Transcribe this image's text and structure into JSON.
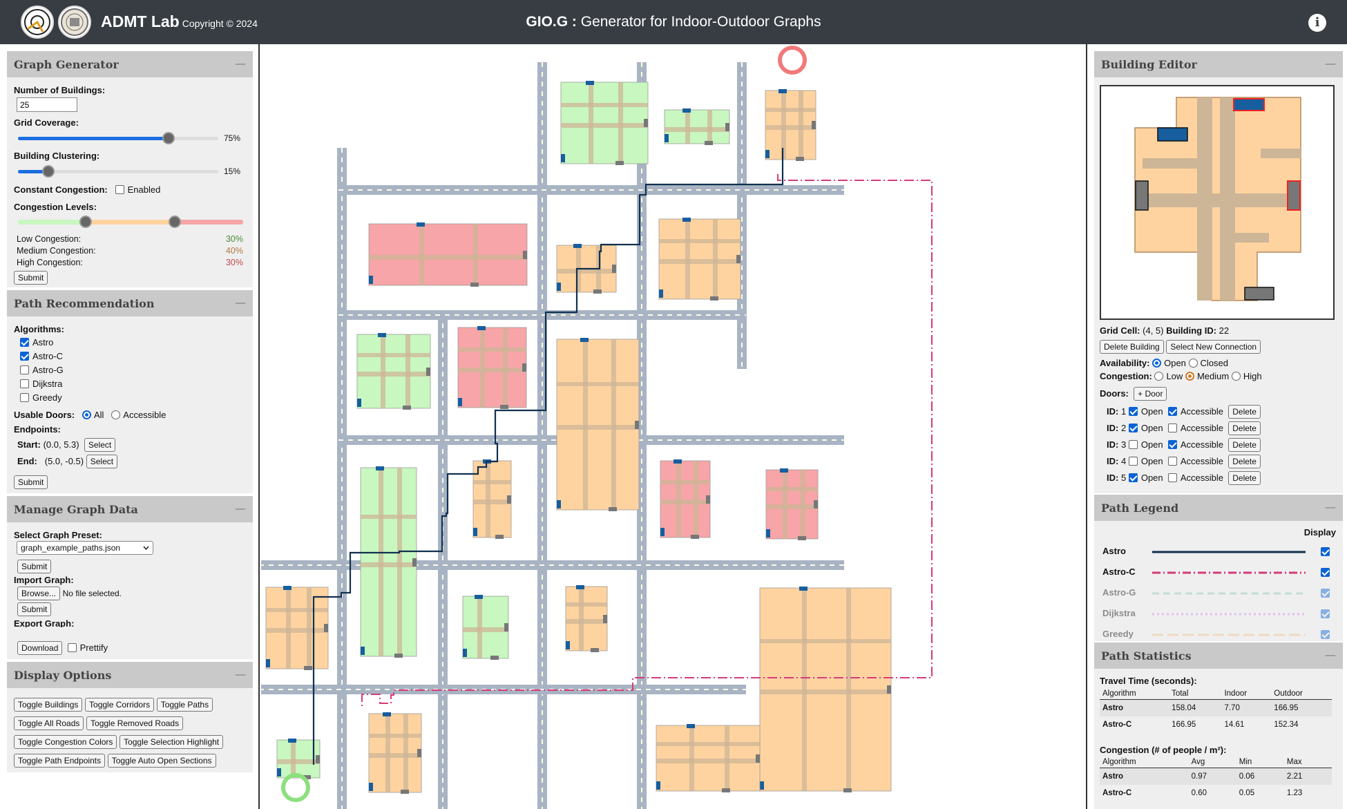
{
  "header": {
    "brand": "ADMT Lab",
    "copyright": "Copyright © 2024",
    "title_bold": "GIO.G :",
    "title_rest": " Generator for Indoor-Outdoor Graphs",
    "info_glyph": "i"
  },
  "generator": {
    "title": "Graph Generator",
    "minimize": "—",
    "num_buildings_label": "Number of Buildings:",
    "num_buildings_value": "25",
    "grid_coverage_label": "Grid Coverage:",
    "grid_coverage_value": "75%",
    "grid_coverage_fraction": 0.75,
    "clustering_label": "Building Clustering:",
    "clustering_value": "15%",
    "clustering_fraction": 0.15,
    "constant_congestion_label": "Constant Congestion:",
    "enabled_label": "Enabled",
    "congestion_levels_label": "Congestion Levels:",
    "low_label": "Low Congestion:",
    "low_value": "30%",
    "medium_label": "Medium Congestion:",
    "medium_value": "40%",
    "high_label": "High Congestion:",
    "high_value": "30%",
    "submit": "Submit"
  },
  "path_rec": {
    "title": "Path Recommendation",
    "minimize": "—",
    "algorithms_label": "Algorithms:",
    "algorithms": [
      {
        "name": "Astro",
        "checked": true
      },
      {
        "name": "Astro-C",
        "checked": true
      },
      {
        "name": "Astro-G",
        "checked": false
      },
      {
        "name": "Dijkstra",
        "checked": false
      },
      {
        "name": "Greedy",
        "checked": false
      }
    ],
    "usable_doors_label": "Usable Doors:",
    "doors_all": "All",
    "doors_accessible": "Accessible",
    "endpoints_label": "Endpoints:",
    "start_label": "Start:",
    "start_value": "(0.0, 5.3)",
    "end_label": "End:",
    "end_value": "(5.0, -0.5)",
    "select": "Select",
    "submit": "Submit"
  },
  "manage": {
    "title": "Manage Graph Data",
    "minimize": "—",
    "preset_label": "Select Graph Preset:",
    "preset_value": "graph_example_paths.json",
    "submit": "Submit",
    "import_label": "Import Graph:",
    "browse": "Browse...",
    "no_file": "No file selected.",
    "export_label": "Export Graph:",
    "download": "Download",
    "prettify": "Prettify"
  },
  "display": {
    "title": "Display Options",
    "minimize": "—",
    "buttons": [
      "Toggle Buildings",
      "Toggle Corridors",
      "Toggle Paths",
      "Toggle All Roads",
      "Toggle Removed Roads",
      "Toggle Congestion Colors",
      "Toggle Selection Highlight",
      "Toggle Path Endpoints",
      "Toggle Auto Open Sections"
    ]
  },
  "editor": {
    "title": "Building Editor",
    "minimize": "—",
    "grid_cell_label": "Grid Cell:",
    "grid_cell_value": "(4, 5)",
    "building_id_label": "Building ID:",
    "building_id_value": "22",
    "delete_building": "Delete Building",
    "select_connection": "Select New Connection",
    "availability_label": "Availability:",
    "open": "Open",
    "closed": "Closed",
    "congestion_label": "Congestion:",
    "low": "Low",
    "medium": "Medium",
    "high": "High",
    "doors_label": "Doors:",
    "add_door": "+ Door",
    "id_label": "ID:",
    "accessible": "Accessible",
    "delete": "Delete",
    "doors": [
      {
        "id": "1",
        "open": true,
        "accessible": true
      },
      {
        "id": "2",
        "open": true,
        "accessible": false
      },
      {
        "id": "3",
        "open": false,
        "accessible": true
      },
      {
        "id": "4",
        "open": false,
        "accessible": false
      },
      {
        "id": "5",
        "open": true,
        "accessible": false
      }
    ]
  },
  "legend": {
    "title": "Path Legend",
    "minimize": "—",
    "display_label": "Display",
    "items": [
      {
        "name": "Astro",
        "color": "#10304f",
        "dash": "solid",
        "active": true
      },
      {
        "name": "Astro-C",
        "color": "#d63a7a",
        "dash": "dashdot",
        "active": true
      },
      {
        "name": "Astro-G",
        "color": "#8dc7b4",
        "dash": "dash",
        "active": false
      },
      {
        "name": "Dijkstra",
        "color": "#d486e8",
        "dash": "dot",
        "active": false
      },
      {
        "name": "Greedy",
        "color": "#efc08c",
        "dash": "longdash",
        "active": false
      }
    ]
  },
  "stats": {
    "title": "Path Statistics",
    "minimize": "—",
    "travel_title": "Travel Time (seconds):",
    "travel_headers": [
      "Algorithm",
      "Total",
      "Indoor",
      "Outdoor"
    ],
    "travel_rows": [
      [
        "Astro",
        "158.04",
        "7.70",
        "166.95"
      ],
      [
        "Astro-C",
        "166.95",
        "14.61",
        "152.34"
      ]
    ],
    "congestion_title": "Congestion (# of people / m²):",
    "congestion_headers": [
      "Algorithm",
      "Avg",
      "Min",
      "Max"
    ],
    "congestion_rows": [
      [
        "Astro",
        "0.97",
        "0.06",
        "2.21"
      ],
      [
        "Astro-C",
        "0.60",
        "0.05",
        "1.23"
      ]
    ]
  },
  "colors": {
    "low": "#c8f7c0",
    "medium": "#ffd3a0",
    "high": "#f7a5a8",
    "road": "#a8b4c4",
    "corridor": "#cdb597",
    "door": "#175e9e",
    "door_closed": "#777777",
    "start": "#8de07f",
    "end": "#f07a7a"
  }
}
